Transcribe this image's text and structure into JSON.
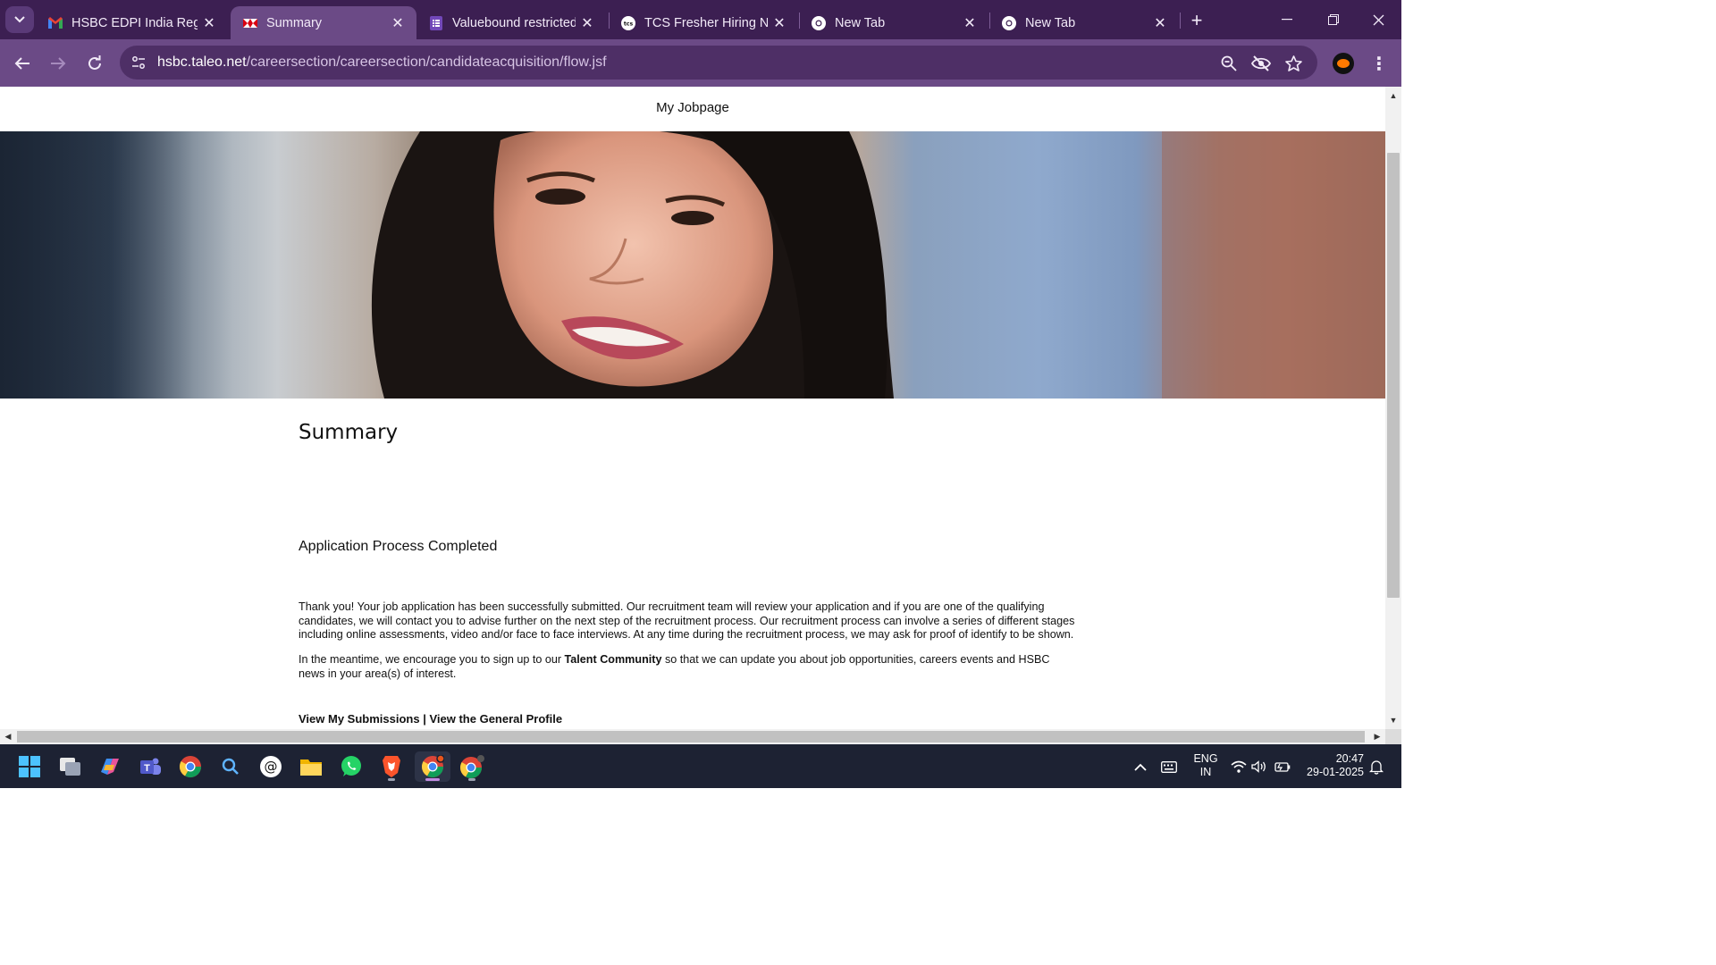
{
  "browser": {
    "tabs": [
      {
        "title": "HSBC EDPI India Regis",
        "favicon": "gmail-icon",
        "active": false
      },
      {
        "title": "Summary",
        "favicon": "hsbc-icon",
        "active": true
      },
      {
        "title": "Valuebound restricted",
        "favicon": "forms-icon",
        "active": false
      },
      {
        "title": "TCS Fresher Hiring NQ",
        "favicon": "tcs-icon",
        "active": false
      },
      {
        "title": "New Tab",
        "favicon": "chrome-icon",
        "active": false
      },
      {
        "title": "New Tab",
        "favicon": "chrome-icon",
        "active": false
      }
    ],
    "url_host": "hsbc.taleo.net",
    "url_path": "/careersection/careersection/candidateacquisition/flow.jsf",
    "colors": {
      "tabstrip": "#3c1f52",
      "toolbar": "#6b4a86",
      "omnibox": "#4e2f66"
    }
  },
  "page": {
    "top_link": "My Jobpage",
    "title": "Summary",
    "subtitle": "Application Process Completed",
    "paragraph1": "Thank you! Your job application has been successfully submitted. Our recruitment team will review your application and if you are one of the qualifying candidates, we will contact you to advise further on the next step of the recruitment process. Our recruitment process can involve a series of different stages including online assessments, video and/or face to face interviews. At any time during the recruitment process, we may ask for proof of identify to be shown.",
    "paragraph2_before": "In the meantime, we encourage you to sign up to our ",
    "paragraph2_link": "Talent Community",
    "paragraph2_after": " so that we can update you about job opportunities, careers events and HSBC news in your area(s) of interest.",
    "link_submissions": "View My Submissions",
    "link_separator": " | ",
    "link_profile": "View the General Profile"
  },
  "taskbar": {
    "apps": [
      "start-icon",
      "task-view-icon",
      "copilot-icon",
      "teams-icon",
      "chrome-icon",
      "search-icon",
      "threads-icon",
      "file-explorer-icon",
      "whatsapp-icon",
      "brave-icon",
      "chrome-active-icon",
      "chrome-profile-icon"
    ],
    "language_line1": "ENG",
    "language_line2": "IN",
    "time": "20:47",
    "date": "29-01-2025"
  }
}
